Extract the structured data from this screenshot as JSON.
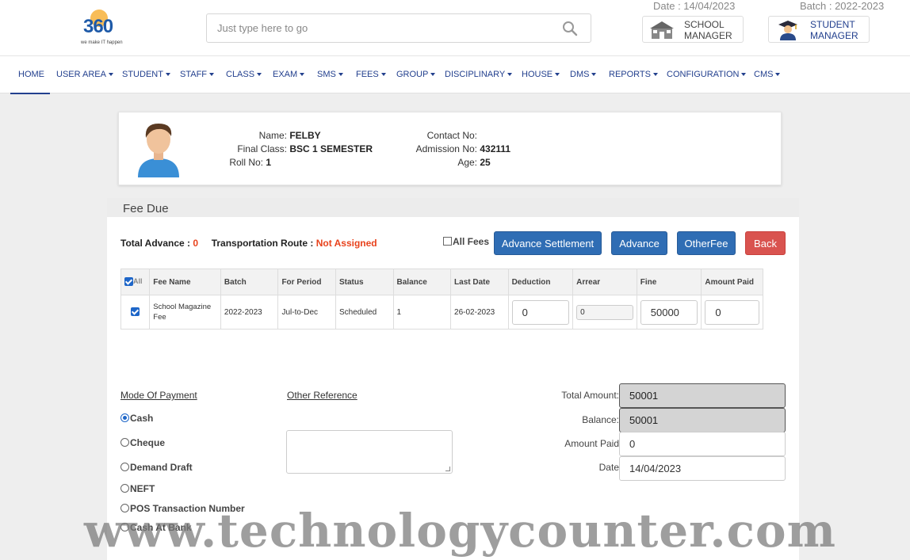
{
  "header": {
    "logo_text": "360",
    "logo_tagline": "we make IT happen",
    "search_placeholder": "Just type here to go",
    "date": "Date : 14/04/2023",
    "batch": "Batch : 2022-2023",
    "school_manager": {
      "line1": "SCHOOL",
      "line2": "MANAGER"
    },
    "student_manager": {
      "line1": "STUDENT",
      "line2": "MANAGER"
    }
  },
  "nav": {
    "home": "HOME",
    "items": [
      "USER AREA",
      "STUDENT",
      "STAFF",
      "CLASS",
      "EXAM",
      "SMS",
      "FEES",
      "GROUP",
      "DISCIPLINARY",
      "HOUSE",
      "DMS",
      "REPORTS",
      "CONFIGURATION",
      "CMS"
    ]
  },
  "student": {
    "name_label": "Name:",
    "name": "FELBY",
    "class_label": "Final Class:",
    "class": "BSC 1 SEMESTER",
    "roll_label": "Roll No:",
    "roll": "1",
    "contact_label": "Contact No:",
    "contact": "",
    "admission_label": "Admission No:",
    "admission": "432111",
    "age_label": "Age:",
    "age": "25"
  },
  "fee_due": {
    "title": "Fee Due",
    "total_advance_label": "Total Advance :",
    "total_advance": "0",
    "route_label": "Transportation Route :",
    "route": "Not Assigned",
    "all_fees_label": "All Fees",
    "buttons": {
      "advance_settlement": "Advance Settlement",
      "advance": "Advance",
      "other_fee": "OtherFee",
      "back": "Back"
    },
    "table": {
      "headers": [
        "All",
        "Fee Name",
        "Batch",
        "For Period",
        "Status",
        "Balance",
        "Last Date",
        "Deduction",
        "Arrear",
        "Fine",
        "Amount Paid"
      ],
      "rows": [
        {
          "checked": true,
          "fee_name": "School Magazine Fee",
          "batch": "2022-2023",
          "period": "Jul-to-Dec",
          "status": "Scheduled",
          "balance": "1",
          "last_date": "26-02-2023",
          "deduction": "0",
          "arrear": "0",
          "fine": "50000",
          "amount_paid": "0"
        }
      ]
    }
  },
  "payment": {
    "mode_label": "Mode Of Payment",
    "other_ref_label": "Other Reference",
    "options": [
      "Cash",
      "Cheque",
      "Demand Draft",
      "NEFT",
      "POS Transaction Number",
      "Cash At Bank"
    ],
    "selected": "Cash",
    "total_amount_label": "Total Amount:",
    "total_amount": "50001",
    "balance_label": "Balance:",
    "balance": "50001",
    "amount_paid_label": "Amount Paid",
    "amount_paid": "0",
    "date_label": "Date",
    "date": "14/04/2023"
  },
  "watermark": "www.technologycounter.com",
  "colors": {
    "brand_blue": "#23408e",
    "button_blue": "#2f6db4",
    "button_red": "#d9534f",
    "alert_red": "#e8421c"
  }
}
